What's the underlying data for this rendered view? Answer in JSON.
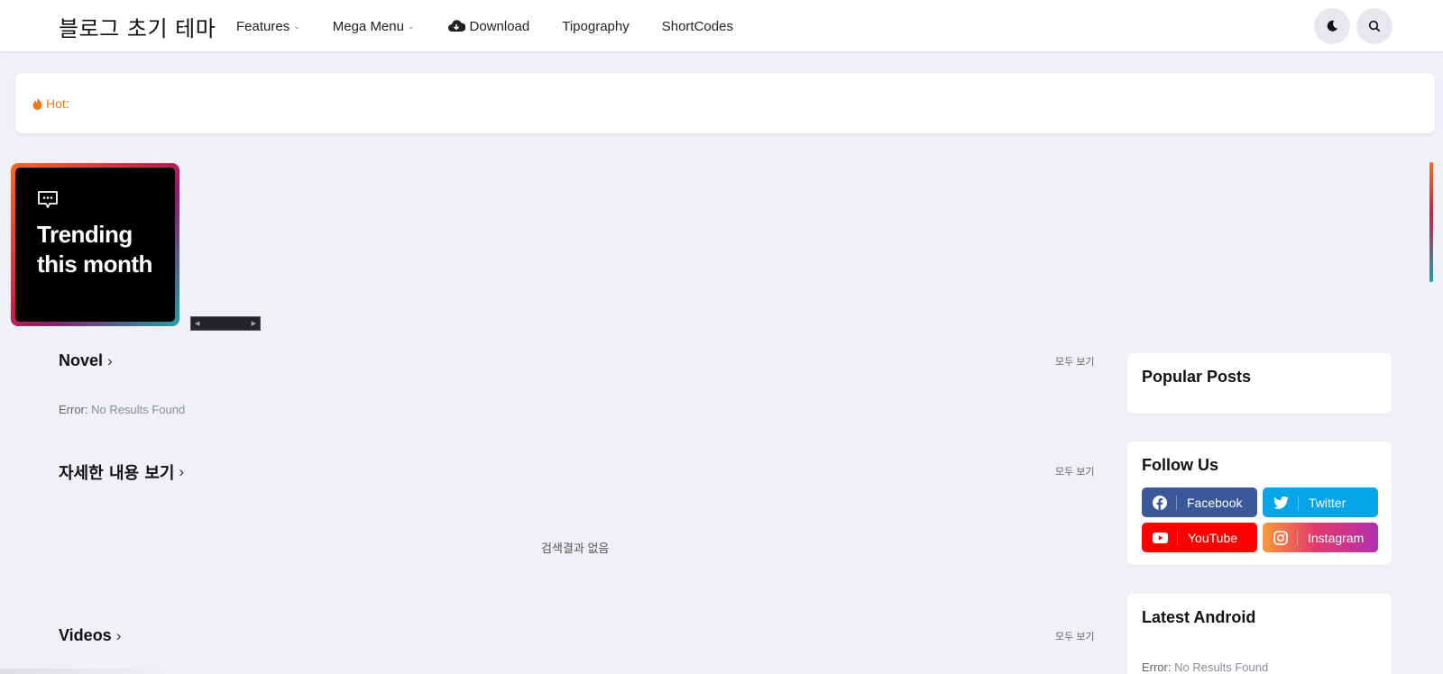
{
  "header": {
    "logo": "블로그 초기 테마",
    "nav": [
      {
        "label": "Features",
        "has_dropdown": true
      },
      {
        "label": "Mega Menu",
        "has_dropdown": true
      },
      {
        "label": "Download",
        "icon": "cloud-download-icon"
      },
      {
        "label": "Tipography"
      },
      {
        "label": "ShortCodes"
      }
    ],
    "dark_mode_icon": "moon-icon",
    "search_icon": "search-icon"
  },
  "hotbar": {
    "label": "Hot:",
    "icon": "fire-icon"
  },
  "trending": {
    "icon": "chat-dots-icon",
    "title": "Trending this month"
  },
  "sections": [
    {
      "title": "Novel",
      "view_all": "모두 보기",
      "message_prefix": "Error:",
      "message": "No Results Found"
    },
    {
      "title": "자세한 내용 보기",
      "view_all": "모두 보기",
      "message": "검색결과 없음"
    },
    {
      "title": "Videos",
      "view_all": "모두 보기"
    }
  ],
  "sidebar": {
    "popular": {
      "title": "Popular Posts"
    },
    "follow": {
      "title": "Follow Us",
      "links": [
        {
          "label": "Facebook",
          "icon": "facebook-icon",
          "color": "#3b5998"
        },
        {
          "label": "Twitter",
          "icon": "twitter-icon",
          "color": "#07a4e9"
        },
        {
          "label": "YouTube",
          "icon": "youtube-icon",
          "color": "#ff0000"
        },
        {
          "label": "Instagram",
          "icon": "instagram-icon",
          "color": "#e23b6b"
        }
      ]
    },
    "android": {
      "title": "Latest Android",
      "message_prefix": "Error:",
      "message": "No Results Found"
    }
  },
  "colors": {
    "accent_orange": "#e87b1c",
    "gradient_start": "#f36b21",
    "gradient_mid": "#c0244b",
    "gradient_end": "#20a0a8"
  }
}
